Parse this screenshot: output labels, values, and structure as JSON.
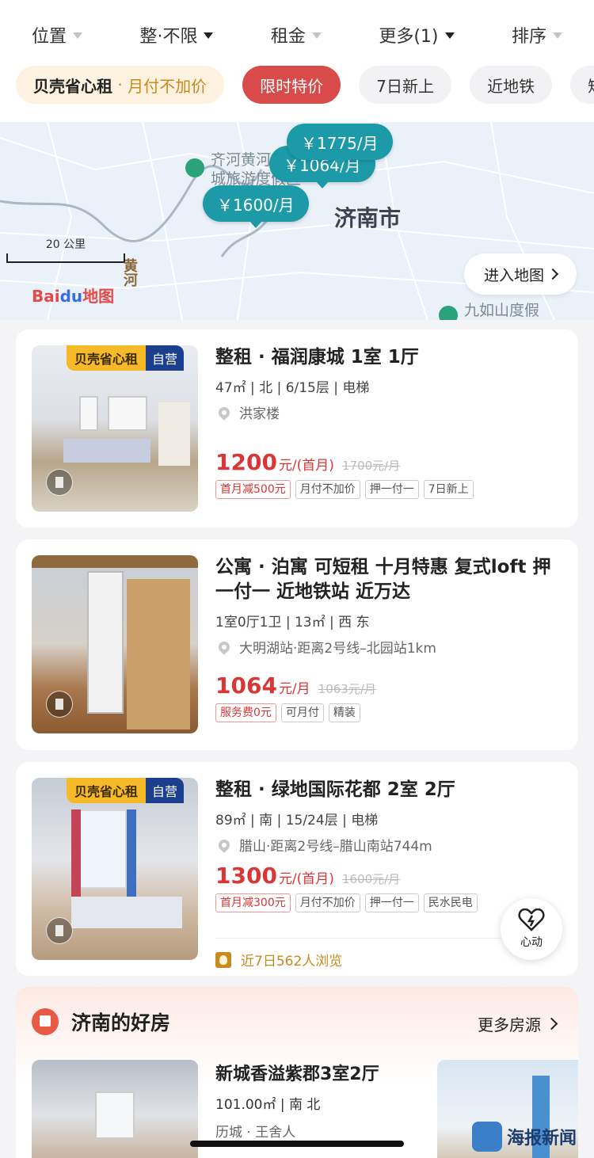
{
  "filters": [
    {
      "label": "位置",
      "active": false
    },
    {
      "label": "整·不限",
      "active": true
    },
    {
      "label": "租金",
      "active": false
    },
    {
      "label": "更多(1)",
      "active": true
    },
    {
      "label": "排序",
      "active": false
    }
  ],
  "chips": {
    "promo_main": "贝壳省心租",
    "promo_sub": "月付不加价",
    "hot": "限时特价",
    "new7": "7日新上",
    "subway": "近地铁",
    "short": "短租"
  },
  "map": {
    "pins": [
      "￥1775/月",
      "￥1064/月",
      "￥1600/月"
    ],
    "poi_label": "齐河黄河\n城旅游度假区",
    "city": "济南市",
    "scale": "20 公里",
    "river": "黄河",
    "logo_bai": "Bai",
    "logo_du": "du",
    "logo_map": "地图",
    "poi2": "九如山度假",
    "enter": "进入地图"
  },
  "listings": [
    {
      "title": "整租 · 福润康城 1室 1厅",
      "meta": "47㎡ | 北 | 6/15层 | 电梯",
      "location": "洪家楼",
      "price": "1200",
      "unit": "元/(首月)",
      "old": "1700元/月",
      "badge1": "贝壳省心租",
      "badge2": "自营",
      "tags": [
        {
          "text": "首月减500元",
          "red": true
        },
        {
          "text": "月付不加价",
          "red": false
        },
        {
          "text": "押一付一",
          "red": false
        },
        {
          "text": "7日新上",
          "red": false
        }
      ]
    },
    {
      "title": "公寓 · 泊寓 可短租 十月特惠 复式loft 押一付一 近地铁站 近万达",
      "meta": "1室0厅1卫 | 13㎡ | 西 东",
      "location": "大明湖站·距离2号线–北园站1km",
      "price": "1064",
      "unit": "元/月",
      "old": "1063元/月",
      "tags": [
        {
          "text": "服务费0元",
          "red": true
        },
        {
          "text": "可月付",
          "red": false
        },
        {
          "text": "精装",
          "red": false
        }
      ]
    },
    {
      "title": "整租 · 绿地国际花都 2室 2厅",
      "meta": "89㎡ | 南 | 15/24层 | 电梯",
      "location": "腊山·距离2号线–腊山南站744m",
      "price": "1300",
      "unit": "元/(首月)",
      "old": "1600元/月",
      "badge1": "贝壳省心租",
      "badge2": "自营",
      "tags": [
        {
          "text": "首月减300元",
          "red": true
        },
        {
          "text": "月付不加价",
          "red": false
        },
        {
          "text": "押一付一",
          "red": false
        },
        {
          "text": "民水民电",
          "red": false
        }
      ],
      "views": "近7日562人浏览"
    }
  ],
  "heart_label": "心动",
  "good": {
    "title": "济南的好房",
    "more": "更多房源",
    "item_title": "新城香溢紫郡3室2厅",
    "item_meta": "101.00㎡ | 南 北",
    "item_area": "历城 · 王舍人"
  },
  "watermark": "海报新闻"
}
